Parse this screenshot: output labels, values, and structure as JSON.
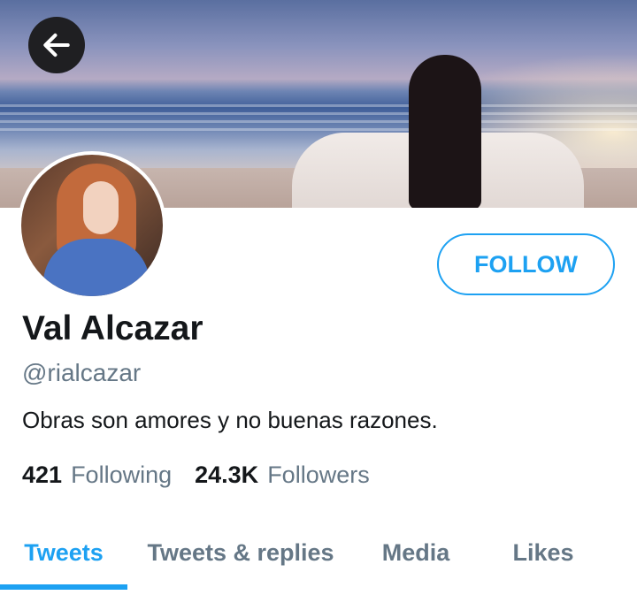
{
  "header": {
    "back_icon": "arrow-left-icon",
    "banner_description_colors": {
      "accent": "#1da1f2",
      "back_button_bg": "#1f1f22"
    }
  },
  "profile": {
    "name": "Val Alcazar",
    "handle": "@rialcazar",
    "bio": "Obras son amores y no buenas razones.",
    "follow_label": "FOLLOW",
    "stats": {
      "following_count": "421",
      "following_label": "Following",
      "followers_count": "24.3K",
      "followers_label": "Followers"
    }
  },
  "tabs": [
    {
      "label": "Tweets",
      "active": true
    },
    {
      "label": "Tweets & replies",
      "active": false
    },
    {
      "label": "Media",
      "active": false
    },
    {
      "label": "Likes",
      "active": false
    }
  ]
}
